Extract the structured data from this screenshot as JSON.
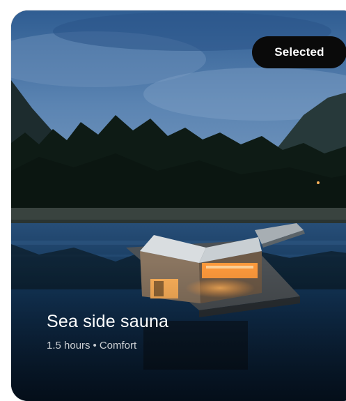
{
  "card": {
    "badge_label": "Selected",
    "title": "Sea side sauna",
    "duration": "1.5 hours",
    "separator": "•",
    "category": "Comfort"
  },
  "colors": {
    "badge_background": "#0a0a0a",
    "badge_text": "#ffffff",
    "title_text": "#ffffff",
    "sky": "#3f6d9e",
    "water": "#0d2b4c",
    "cabin_glow": "#ff9a3c"
  },
  "icons": {
    "card_image": "sauna-photo"
  }
}
